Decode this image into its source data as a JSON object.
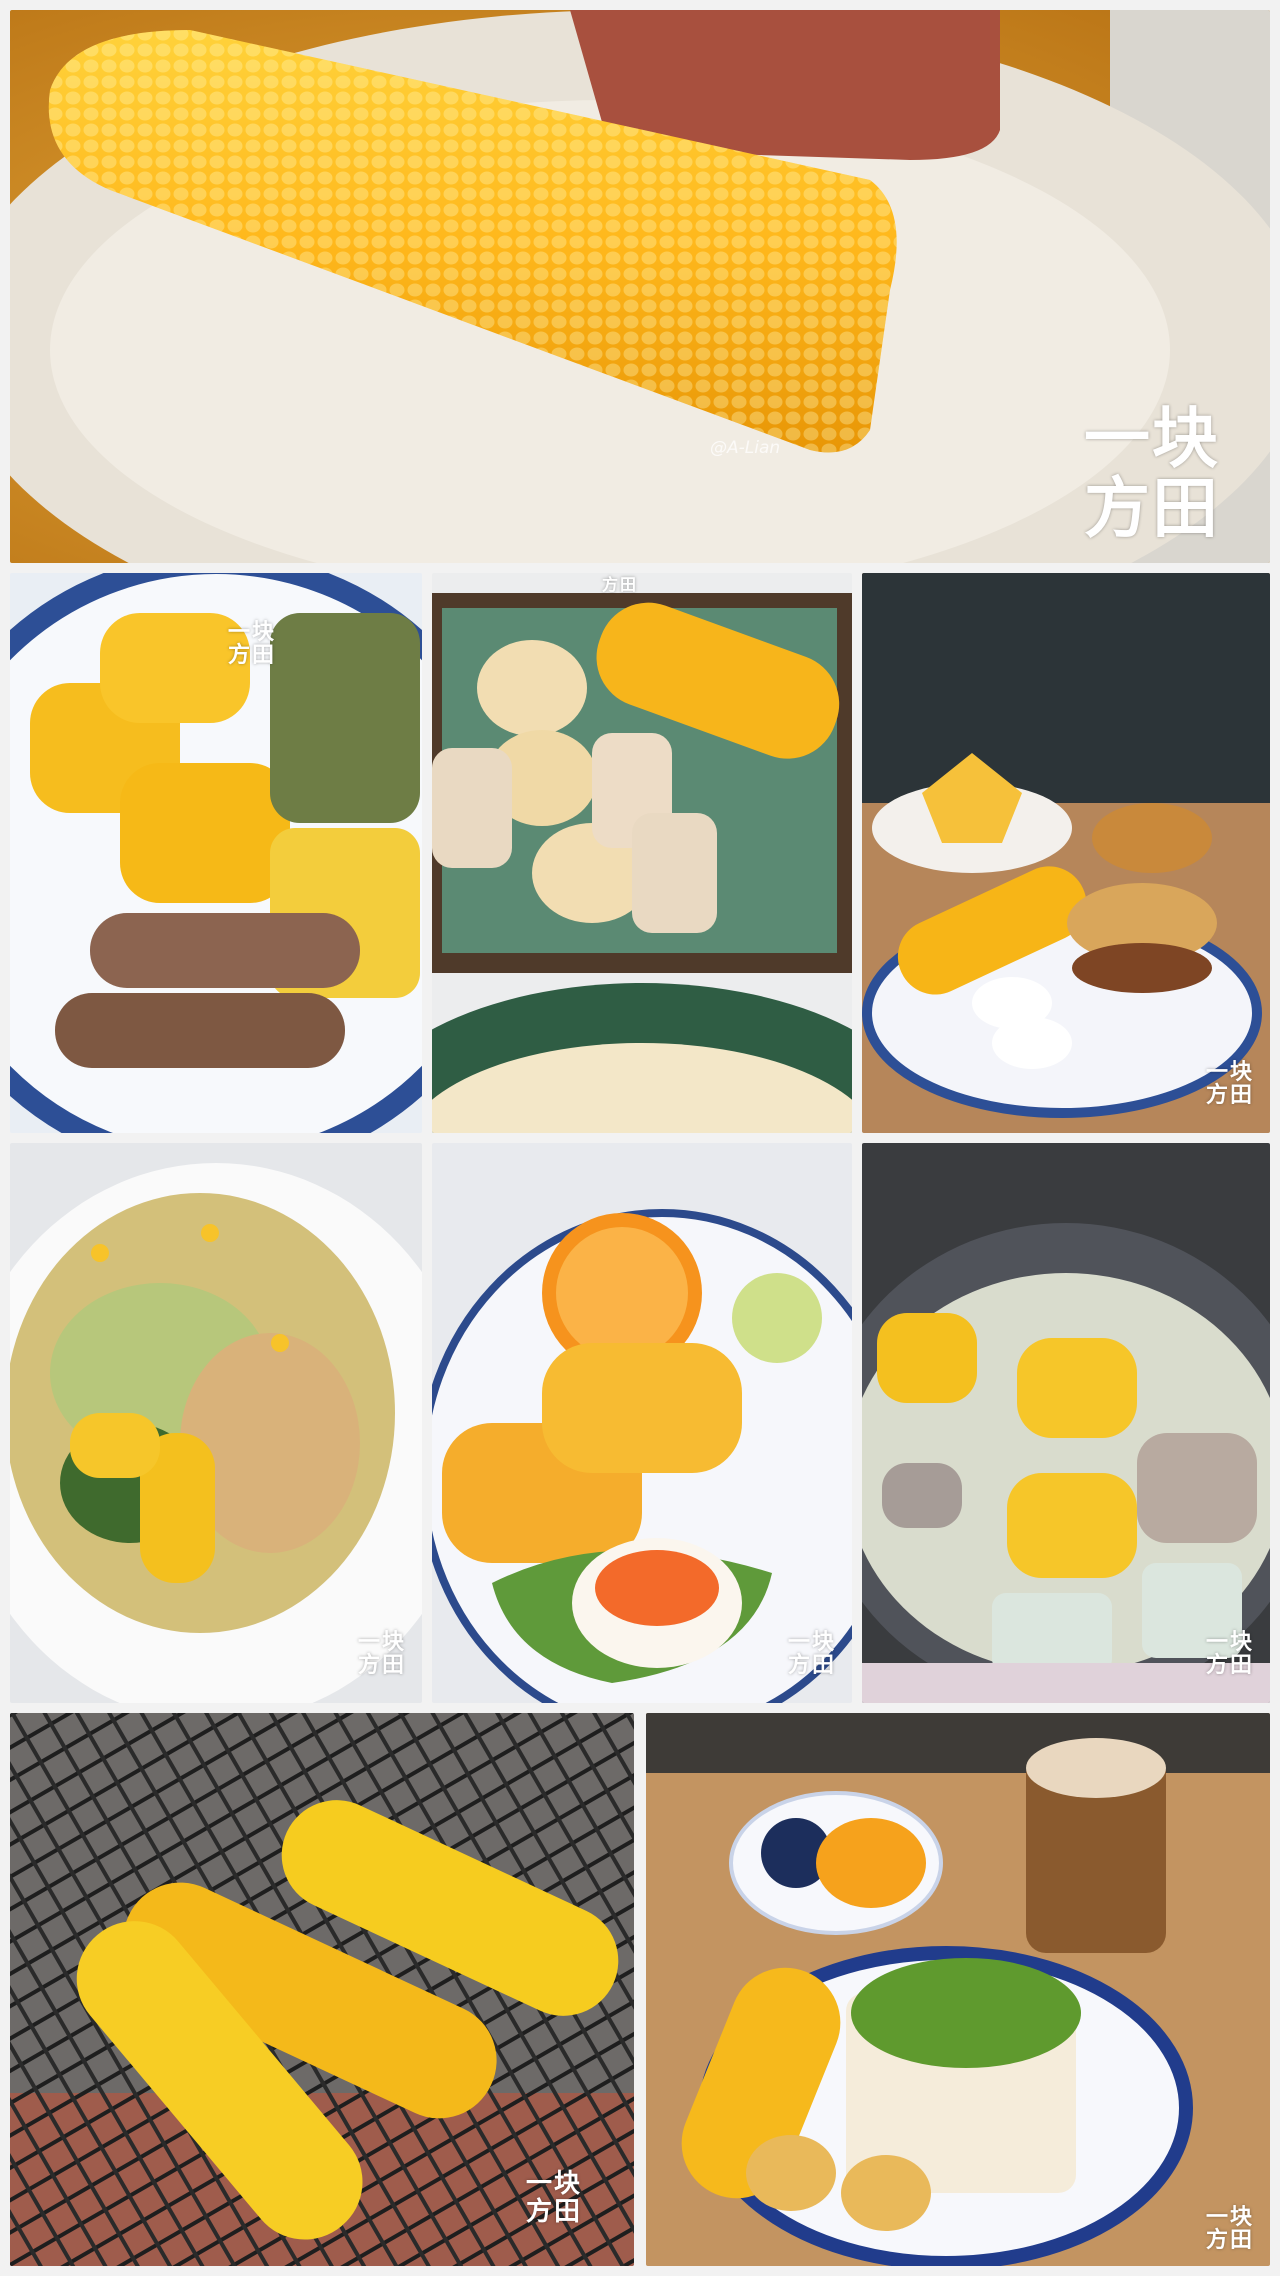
{
  "collage": {
    "background": "#f2f2f2",
    "photos": [
      {
        "name": "boiled-corn-cob-on-plate",
        "watermark": {
          "line1": "一块",
          "line2": "方田"
        },
        "handle": "@A-Lian"
      },
      {
        "name": "corn-sausage-steamed-bun-plate",
        "watermark": {
          "line1": "一块",
          "line2": "方田"
        }
      },
      {
        "name": "corn-dumplings-shumai-plate",
        "watermark": {
          "line1": "方田",
          "line2": ""
        }
      },
      {
        "name": "corn-burger-breakfast",
        "watermark": {
          "line1": "一块",
          "line2": "方田"
        }
      },
      {
        "name": "corn-chicken-stir-fry",
        "watermark": {
          "line1": "一块",
          "line2": "方田"
        }
      },
      {
        "name": "corn-egg-orange-salad",
        "watermark": {
          "line1": "一块",
          "line2": "方田"
        }
      },
      {
        "name": "corn-winter-melon-rib-soup",
        "watermark": {
          "line1": "一块",
          "line2": "方田"
        }
      },
      {
        "name": "grilled-corn-on-barbecue",
        "watermark": {
          "line1": "一块",
          "line2": "方田"
        }
      },
      {
        "name": "corn-avocado-toast-coffee-breakfast",
        "watermark": {
          "line1": "一块",
          "line2": "方田"
        }
      }
    ]
  }
}
